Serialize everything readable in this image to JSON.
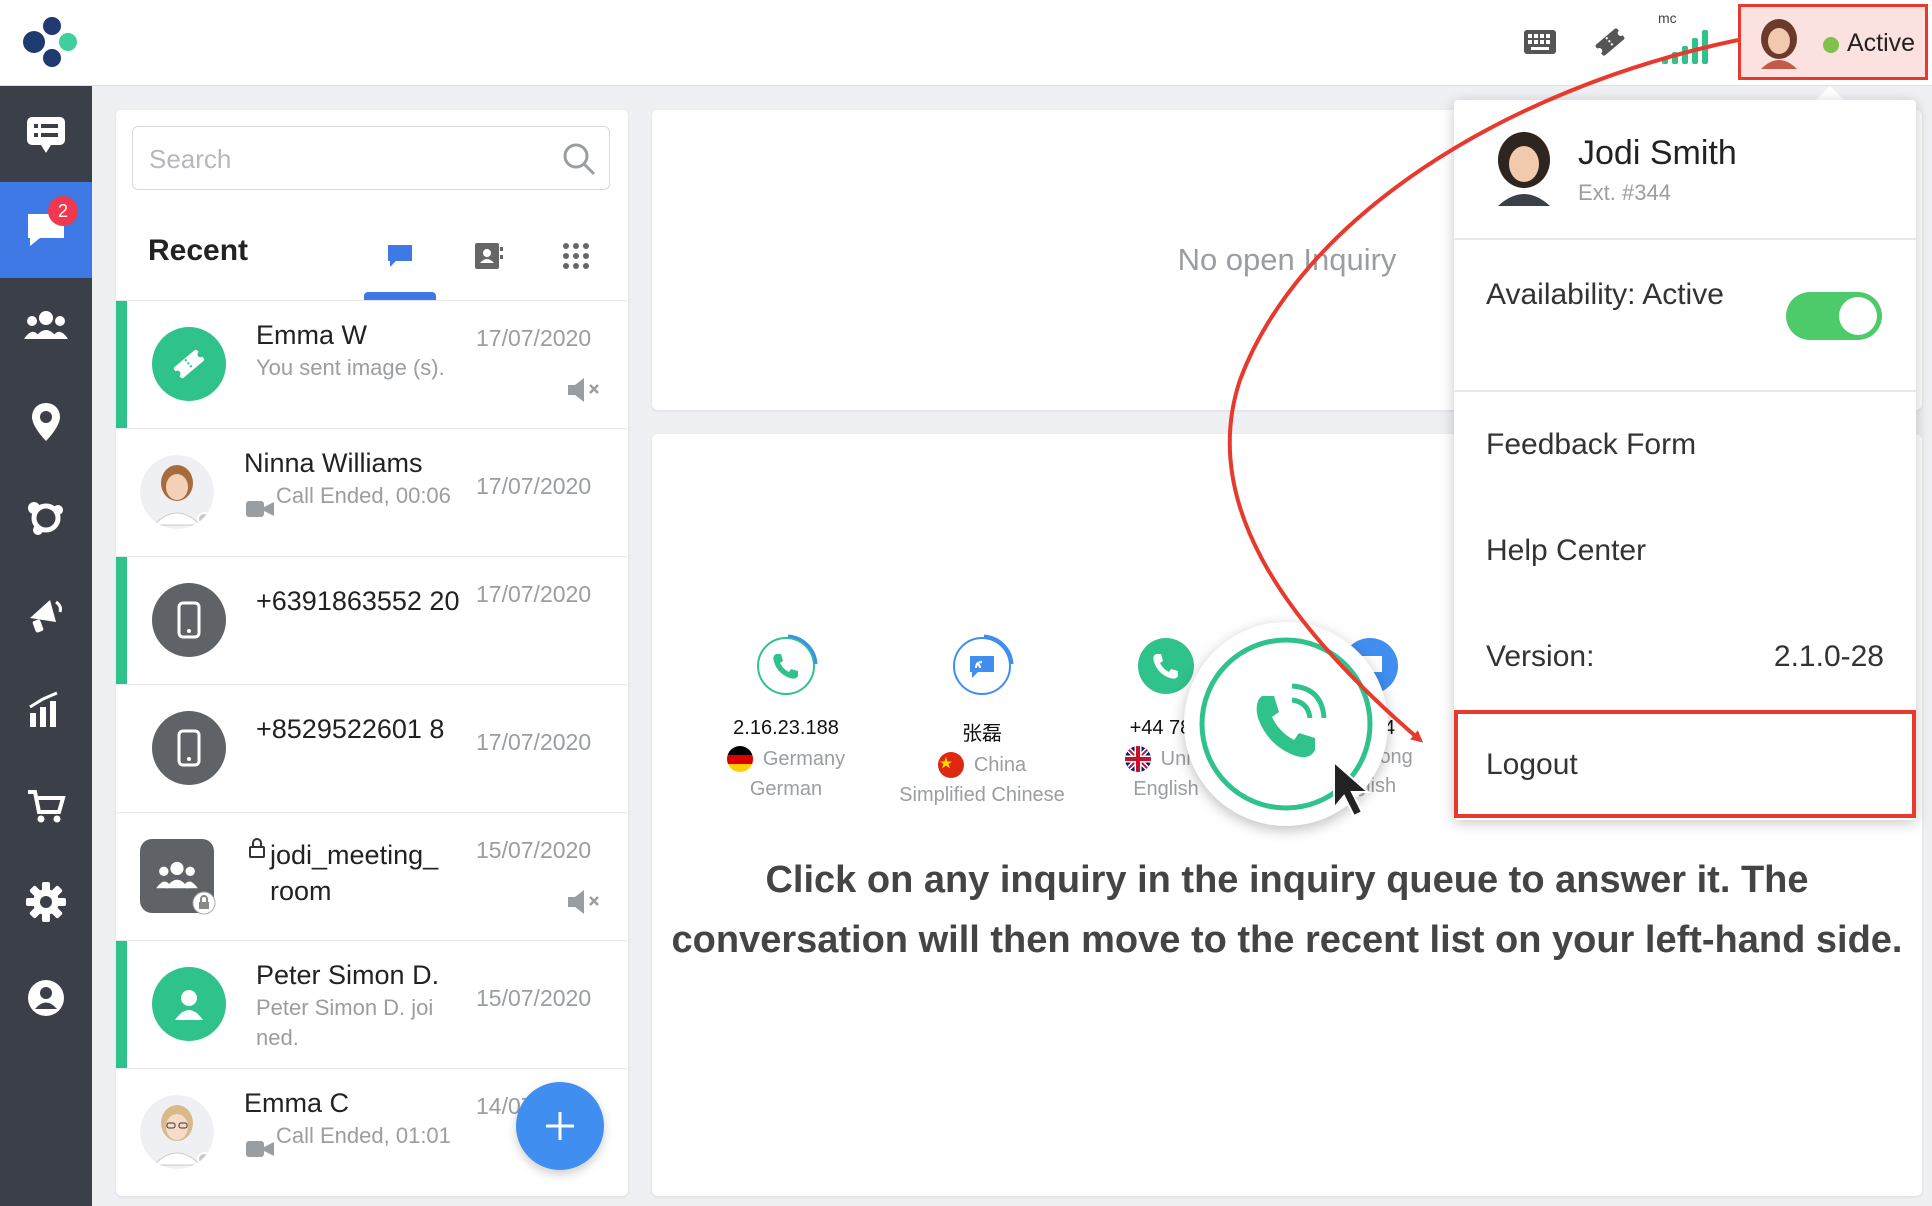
{
  "header": {
    "keyboard_icon": "keyboard-icon",
    "ticket_icon": "ticket-icon",
    "signal_label": "mc",
    "status_label": "Active",
    "status_color": "#7fc14a"
  },
  "sidebar": {
    "items": [
      {
        "name": "inbox-list",
        "icon": "chat-list-icon"
      },
      {
        "name": "conversations",
        "icon": "chat-bubble-icon",
        "badge": "2",
        "active": true
      },
      {
        "name": "contacts",
        "icon": "group-icon"
      },
      {
        "name": "locations",
        "icon": "map-pin-icon"
      },
      {
        "name": "integrations",
        "icon": "network-icon"
      },
      {
        "name": "campaigns",
        "icon": "megaphone-icon"
      },
      {
        "name": "analytics",
        "icon": "bar-chart-icon"
      },
      {
        "name": "store",
        "icon": "cart-icon"
      },
      {
        "name": "settings",
        "icon": "gear-icon"
      },
      {
        "name": "profile",
        "icon": "user-circle-icon"
      }
    ]
  },
  "recent": {
    "search_placeholder": "Search",
    "title": "Recent",
    "items": [
      {
        "name": "Emma W",
        "sub": "You sent image (s).",
        "date": "17/07/2020"
      },
      {
        "name": "Ninna Williams",
        "sub": "Call Ended, 00:06",
        "date": "17/07/2020"
      },
      {
        "name": "+6391863552 20",
        "sub": "",
        "date": "17/07/2020"
      },
      {
        "name": "+8529522601 8",
        "sub": "",
        "date": "17/07/2020"
      },
      {
        "name": "jodi_meeting_ room",
        "sub": "",
        "date": "15/07/2020"
      },
      {
        "name": "Peter Simon D.",
        "sub": "Peter Simon D. joi ned.",
        "date": "15/07/2020"
      },
      {
        "name": "Emma C",
        "sub": "Call Ended, 01:01",
        "date": "14/07/2020"
      }
    ]
  },
  "main": {
    "no_inquiry": "No open Inquiry",
    "queue": [
      {
        "number": "2.16.23.188",
        "country": "Germany",
        "language": "German"
      },
      {
        "number": "张磊",
        "country": "China",
        "language": "Simplified Chinese"
      },
      {
        "number": "+44 785",
        "country": "Unite",
        "language": "English"
      },
      {
        "number": "58.94",
        "country": "ong Kong",
        "language": "nglish"
      }
    ],
    "instruction": "Click on any inquiry in the inquiry queue to answer it. The conversation will then move to the recent list on your left-hand side."
  },
  "dropdown": {
    "user_name": "Jodi Smith",
    "extension": "Ext. #344",
    "availability_label": "Availability: Active",
    "feedback": "Feedback Form",
    "help": "Help Center",
    "version_label": "Version:",
    "version_value": "2.1.0-28",
    "logout": "Logout"
  },
  "colors": {
    "accent_blue": "#3f79e6",
    "green": "#2fc28a",
    "annotation_red": "#e8392e"
  }
}
